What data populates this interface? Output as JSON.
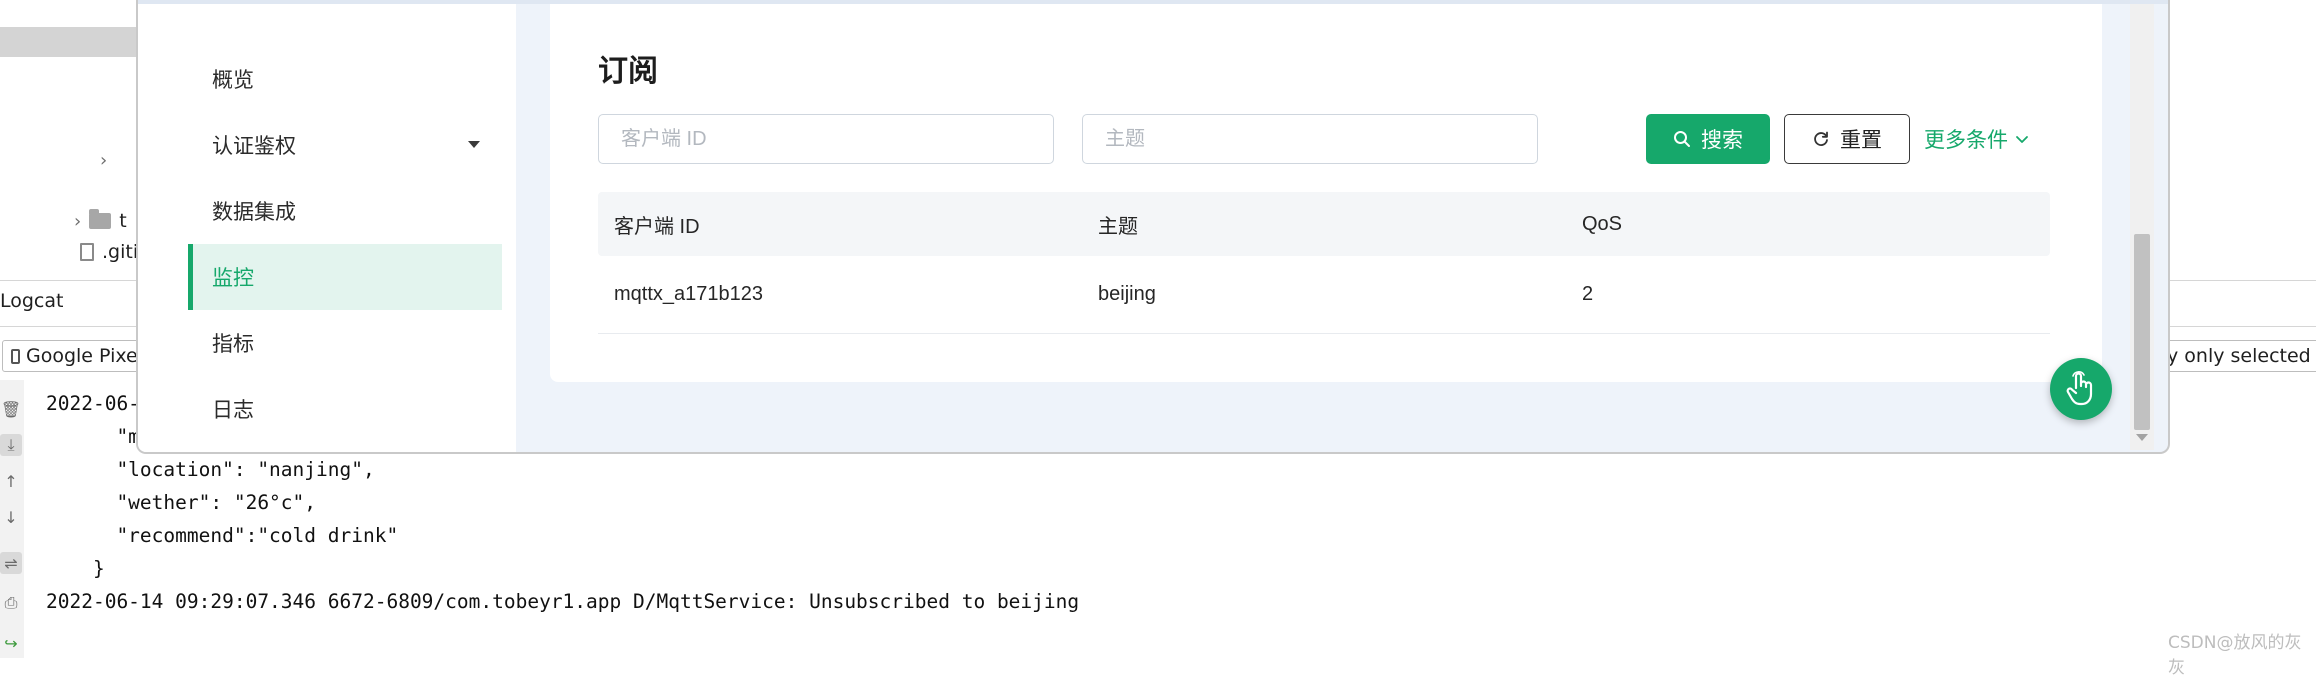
{
  "ide": {
    "tree": [
      {
        "label": ".giti"
      },
      {
        "label": "t"
      }
    ],
    "logcat_title": "Logcat",
    "device_select": "Google Pixe",
    "filter_option": "y only selected ap",
    "log_lines": [
      "2022-06-",
      "      \"m",
      "      \"location\": \"nanjing\",",
      "      \"wether\": \"26°c\",",
      "      \"recommend\":\"cold drink\"",
      "    }",
      "2022-06-14 09:29:07.346 6672-6809/com.tobeyr1.app D/MqttService: Unsubscribed to beijing"
    ],
    "watermark": "CSDN@放风的灰灰"
  },
  "sidebar": {
    "items": [
      {
        "label": "概览",
        "active": false
      },
      {
        "label": "认证鉴权",
        "active": false,
        "has_submenu": true
      },
      {
        "label": "数据集成",
        "active": false
      },
      {
        "label": "监控",
        "active": true
      },
      {
        "label": "指标",
        "active": false
      },
      {
        "label": "日志",
        "active": false
      }
    ]
  },
  "subscriptions": {
    "title": "订阅",
    "filters": {
      "client_id": {
        "placeholder": "客户端 ID",
        "value": ""
      },
      "topic": {
        "placeholder": "主题",
        "value": ""
      }
    },
    "buttons": {
      "search": "搜索",
      "reset": "重置",
      "more": "更多条件"
    },
    "table": {
      "columns": [
        "客户端 ID",
        "主题",
        "QoS"
      ],
      "rows": [
        [
          "mqttx_a171b123",
          "beijing",
          "2"
        ]
      ]
    }
  },
  "theme": {
    "accent": "#16a86b",
    "active_bg": "#e3f4ee",
    "window_bg": "#eef3fa"
  }
}
